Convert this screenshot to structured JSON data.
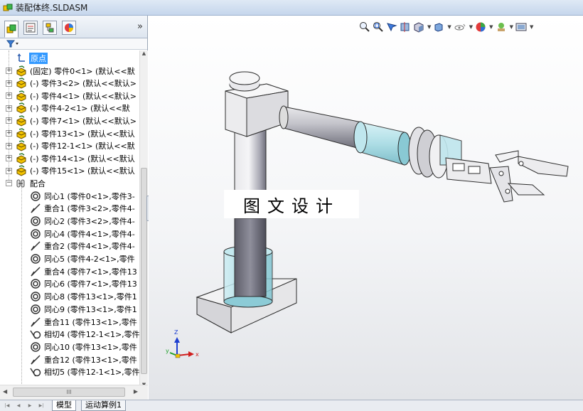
{
  "window": {
    "title": "装配体终.SLDASM"
  },
  "panel": {
    "tabs": [
      "featuremanager-tab",
      "propertymanager-tab",
      "configurationmanager-tab",
      "displaymanager-tab"
    ],
    "more_label": "»"
  },
  "tree": {
    "origin": "原点",
    "components": [
      "(固定) 零件0<1> (默认<<默",
      "(-) 零件3<2> (默认<<默认>",
      "(-) 零件4<1> (默认<<默认>",
      "(-) 零件4-2<1> (默认<<默",
      "(-) 零件7<1> (默认<<默认>",
      "(-) 零件13<1> (默认<<默认",
      "(-) 零件12-1<1> (默认<<默",
      "(-) 零件14<1> (默认<<默认",
      "(-) 零件15<1> (默认<<默认"
    ],
    "mates_folder": "配合",
    "mates": [
      {
        "type": "concentric",
        "label": "同心1 (零件0<1>,零件3-"
      },
      {
        "type": "coincident",
        "label": "重合1 (零件3<2>,零件4-"
      },
      {
        "type": "concentric",
        "label": "同心2 (零件3<2>,零件4-"
      },
      {
        "type": "concentric",
        "label": "同心4 (零件4<1>,零件4-"
      },
      {
        "type": "coincident",
        "label": "重合2 (零件4<1>,零件4-"
      },
      {
        "type": "concentric",
        "label": "同心5 (零件4-2<1>,零件"
      },
      {
        "type": "coincident",
        "label": "重合4 (零件7<1>,零件13"
      },
      {
        "type": "concentric",
        "label": "同心6 (零件7<1>,零件13"
      },
      {
        "type": "concentric",
        "label": "同心8 (零件13<1>,零件1"
      },
      {
        "type": "concentric",
        "label": "同心9 (零件13<1>,零件1"
      },
      {
        "type": "coincident",
        "label": "重合11 (零件13<1>,零件"
      },
      {
        "type": "tangent",
        "label": "相切4 (零件12-1<1>,零件"
      },
      {
        "type": "concentric",
        "label": "同心10 (零件13<1>,零件"
      },
      {
        "type": "coincident",
        "label": "重合12 (零件13<1>,零件"
      },
      {
        "type": "tangent",
        "label": "相切5 (零件12-1<1>,零件"
      }
    ]
  },
  "graphics": {
    "watermark": "图文设计",
    "triad": {
      "x": "x",
      "y": "y",
      "z": "Z"
    }
  },
  "bottom_tabs": [
    "模型",
    "运动算例1"
  ],
  "hscroll_thumb": "III",
  "colors": {
    "selection": "#3399ff",
    "glass": "#a9dde6",
    "part_grey": "#d8d8d8"
  }
}
